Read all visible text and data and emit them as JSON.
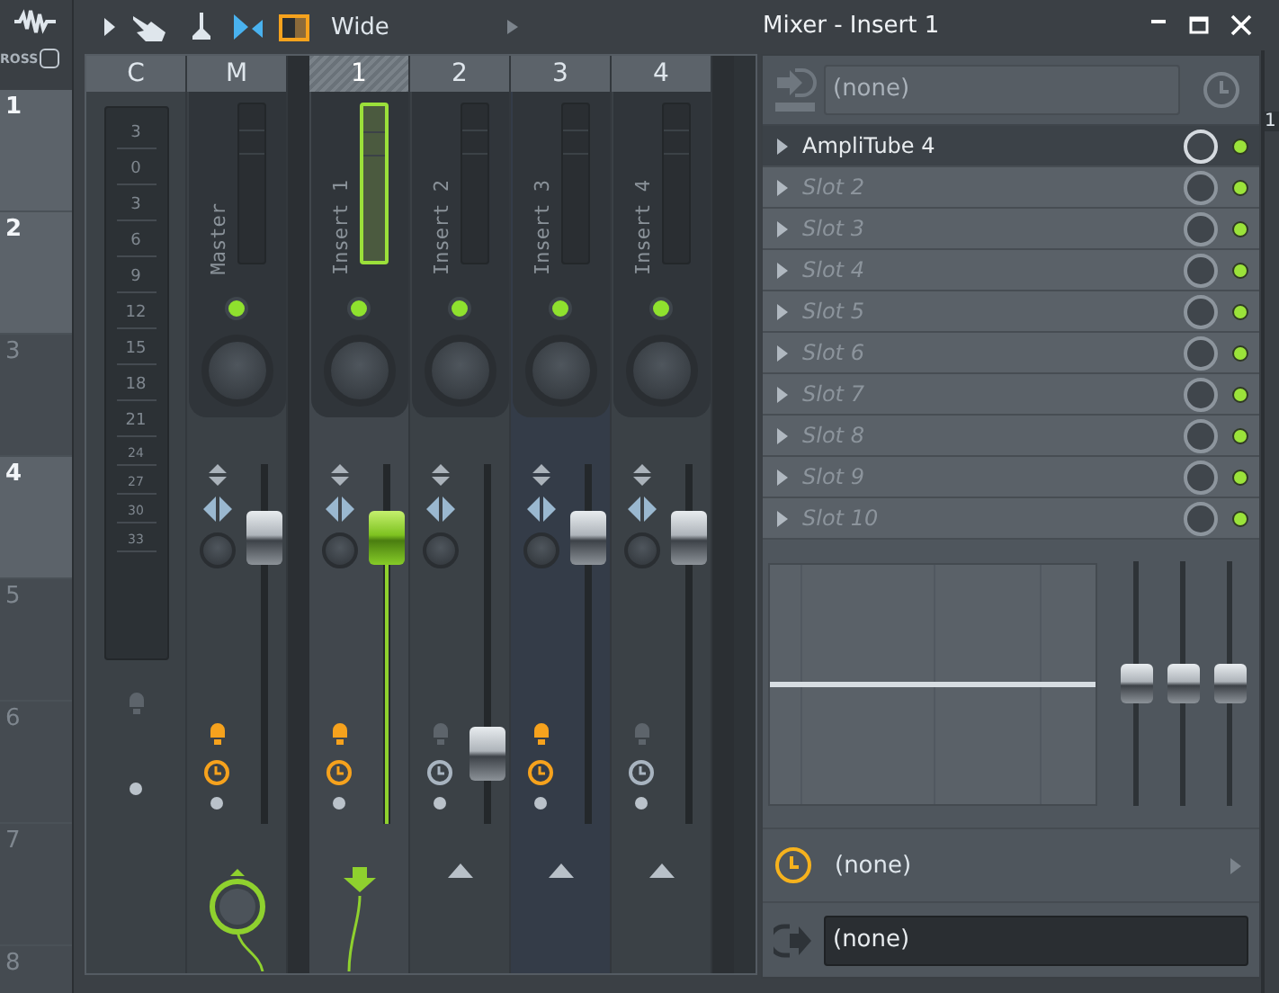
{
  "ruler": {
    "cross_label": "ROSS",
    "cross_on": false,
    "rows": [
      {
        "label": "1",
        "kind": "light"
      },
      {
        "label": "2",
        "kind": "light"
      },
      {
        "label": "3",
        "kind": "dark"
      },
      {
        "label": "4",
        "kind": "light"
      },
      {
        "label": "5",
        "kind": "dark"
      },
      {
        "label": "6",
        "kind": "dark"
      },
      {
        "label": "7",
        "kind": "dark"
      },
      {
        "label": "8",
        "kind": "dark"
      }
    ]
  },
  "toolbar": {
    "preset": "Wide"
  },
  "mixer": {
    "scale": [
      "3",
      "0",
      "3",
      "6",
      "9",
      "12",
      "15",
      "18",
      "21",
      "24",
      "27",
      "30",
      "33"
    ],
    "strips": [
      {
        "kind": "current",
        "header": "C",
        "arm_on": false
      },
      {
        "kind": "channel",
        "header": "M",
        "name": "Master",
        "selected": false,
        "level": 0.85,
        "arm_on": true,
        "clock_on": true,
        "route": {
          "kind": "knob"
        }
      },
      {
        "kind": "channel",
        "header": "1",
        "name": "Insert 1",
        "selected": true,
        "level": 0.85,
        "arm_on": true,
        "clock_on": true,
        "route": {
          "kind": "down"
        }
      },
      {
        "kind": "channel",
        "header": "2",
        "name": "Insert 2",
        "selected": false,
        "level": 0.14,
        "arm_on": false,
        "clock_on": false,
        "route": {
          "kind": "up"
        }
      },
      {
        "kind": "channel",
        "header": "3",
        "name": "Insert 3",
        "selected": false,
        "level": 0.85,
        "arm_on": true,
        "clock_on": true,
        "route": {
          "kind": "up"
        }
      },
      {
        "kind": "channel",
        "header": "4",
        "name": "Insert 4",
        "selected": false,
        "level": 0.85,
        "arm_on": false,
        "clock_on": false,
        "route": {
          "kind": "up"
        }
      }
    ]
  },
  "panel": {
    "title": "Mixer - Insert 1",
    "input": "(none)",
    "slots": [
      {
        "name": "AmpliTube 4",
        "empty": false
      },
      {
        "name": "Slot 2",
        "empty": true
      },
      {
        "name": "Slot 3",
        "empty": true
      },
      {
        "name": "Slot 4",
        "empty": true
      },
      {
        "name": "Slot 5",
        "empty": true
      },
      {
        "name": "Slot 6",
        "empty": true
      },
      {
        "name": "Slot 7",
        "empty": true
      },
      {
        "name": "Slot 8",
        "empty": true
      },
      {
        "name": "Slot 9",
        "empty": true
      },
      {
        "name": "Slot 10",
        "empty": true
      }
    ],
    "eq_faders": [
      {
        "level": 0.5
      },
      {
        "level": 0.5
      },
      {
        "level": 0.5
      }
    ],
    "link": "(none)",
    "output": "(none)",
    "edge_label": "1"
  }
}
